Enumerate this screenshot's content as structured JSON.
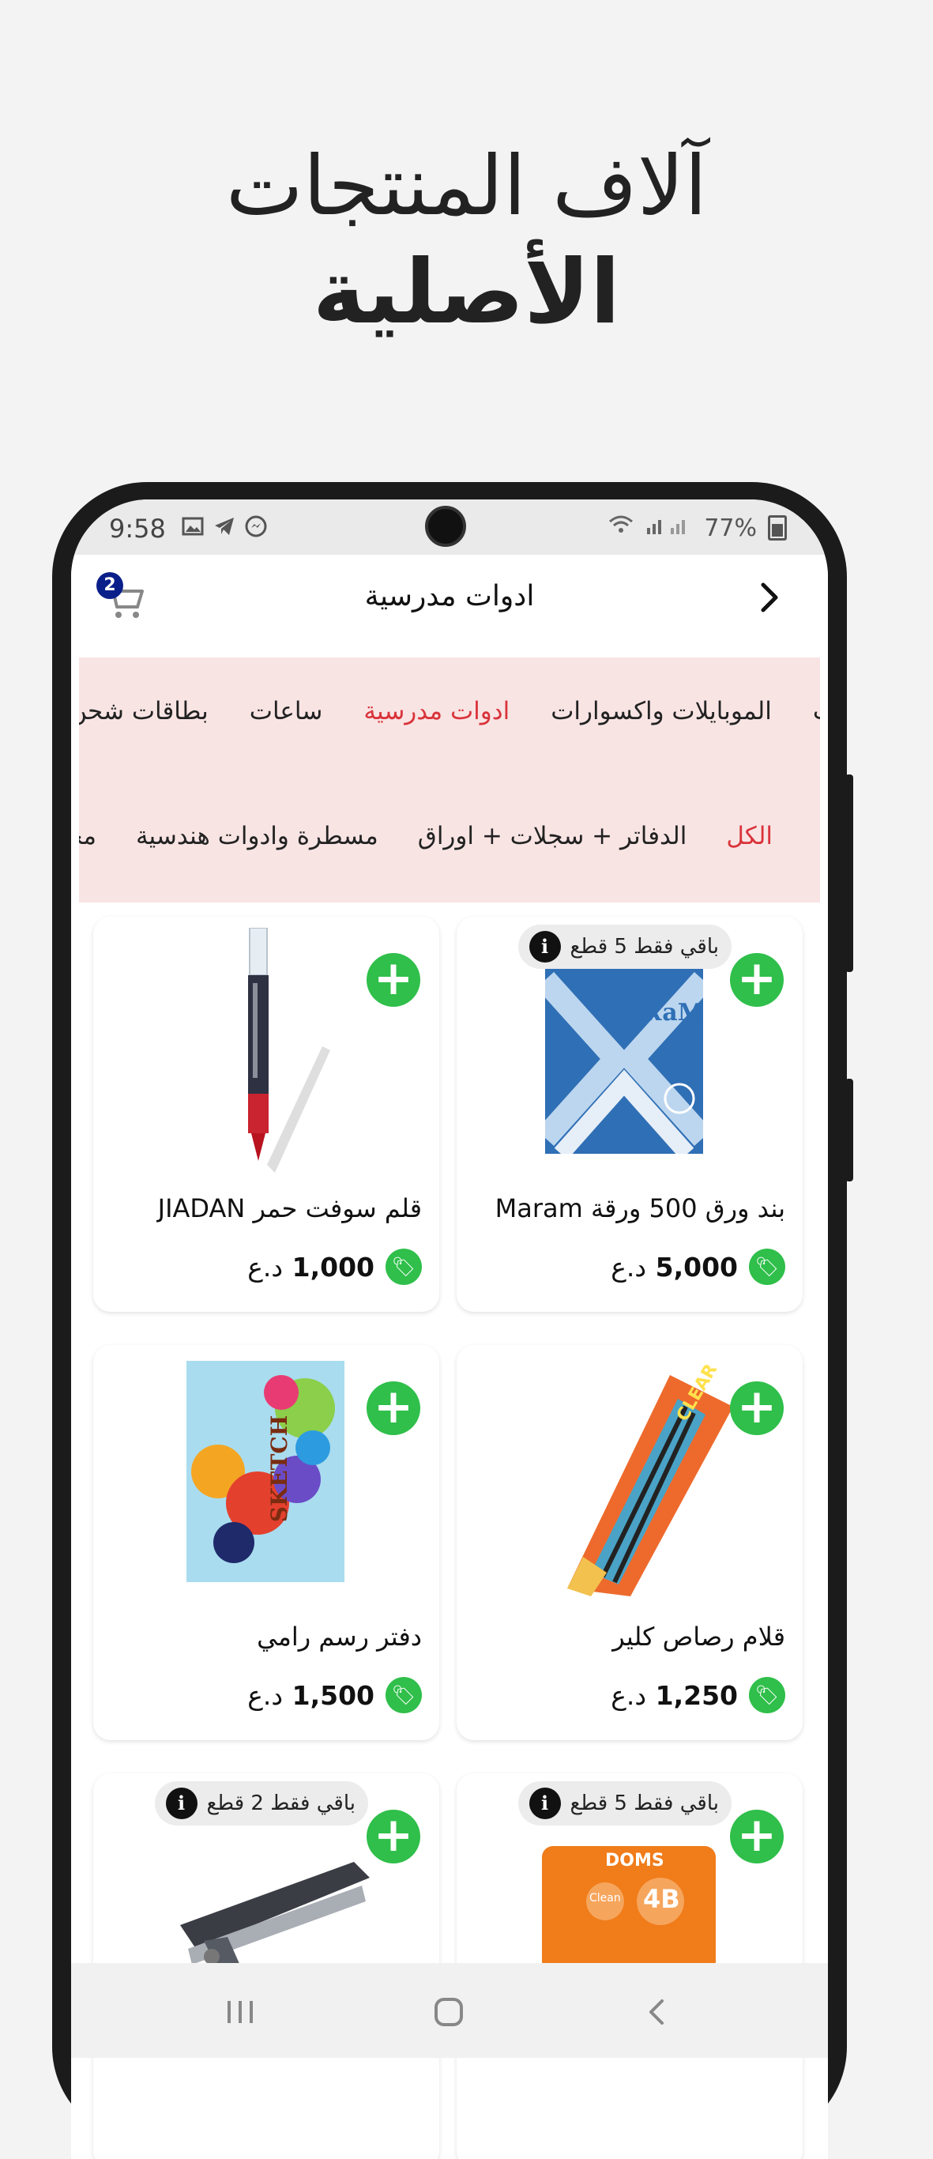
{
  "headline": {
    "line1": "آلاف المنتجات",
    "line2": "الأصلية"
  },
  "status_bar": {
    "time": "9:58",
    "battery": "77%"
  },
  "app_bar": {
    "title": "ادوات مدرسية",
    "cart_count": "2"
  },
  "categories": [
    "الموبايلات واكسوارات",
    "ادوات مدرسية",
    "ساعات",
    "بطاقات شحن"
  ],
  "categories_partial_right": "ت",
  "active_category": "ادوات مدرسية",
  "subcategories": [
    "الكل",
    "الدفاتر + سجلات + اوراق",
    "مسطرة وادوات هندسية",
    "محـ"
  ],
  "active_subcategory": "الكل",
  "products": [
    {
      "name": "بند ورق 500 ورقة Maram",
      "price": "5,000",
      "currency": "د.ع",
      "stock": "باقي فقط 5 قطع",
      "image": "maram-paper-ream"
    },
    {
      "name": "قلم سوفت حمر JIADAN",
      "price": "1,000",
      "currency": "د.ع",
      "stock": "",
      "image": "red-pen"
    },
    {
      "name": "قلام رصاص كلير",
      "price": "1,250",
      "currency": "د.ع",
      "stock": "",
      "image": "pencils-pack"
    },
    {
      "name": "دفتر رسم رامي",
      "price": "1,500",
      "currency": "د.ع",
      "stock": "",
      "image": "sketch-book"
    },
    {
      "name": "",
      "price": "",
      "currency": "",
      "stock": "باقي فقط 5 قطع",
      "image": "eraser"
    },
    {
      "name": "",
      "price": "",
      "currency": "",
      "stock": "باقي فقط 2 قطع",
      "image": "stapler"
    }
  ],
  "eraser_text": {
    "brand": "DOMS",
    "model": "4B",
    "label": "Clean"
  },
  "maram_logo": "MaRaM",
  "sketch_label": "SKETCH",
  "pencil_brand": "CLEAR",
  "icons": {
    "cart": "cart-icon",
    "back": "chevron-right-icon",
    "add": "plus-icon",
    "tag": "price-tag-icon",
    "info": "info-icon"
  },
  "colors": {
    "accent_green": "#2fbf4a",
    "active_red": "#d9333a",
    "category_band": "#f9e4e4",
    "badge_navy": "#0b1f8a"
  }
}
